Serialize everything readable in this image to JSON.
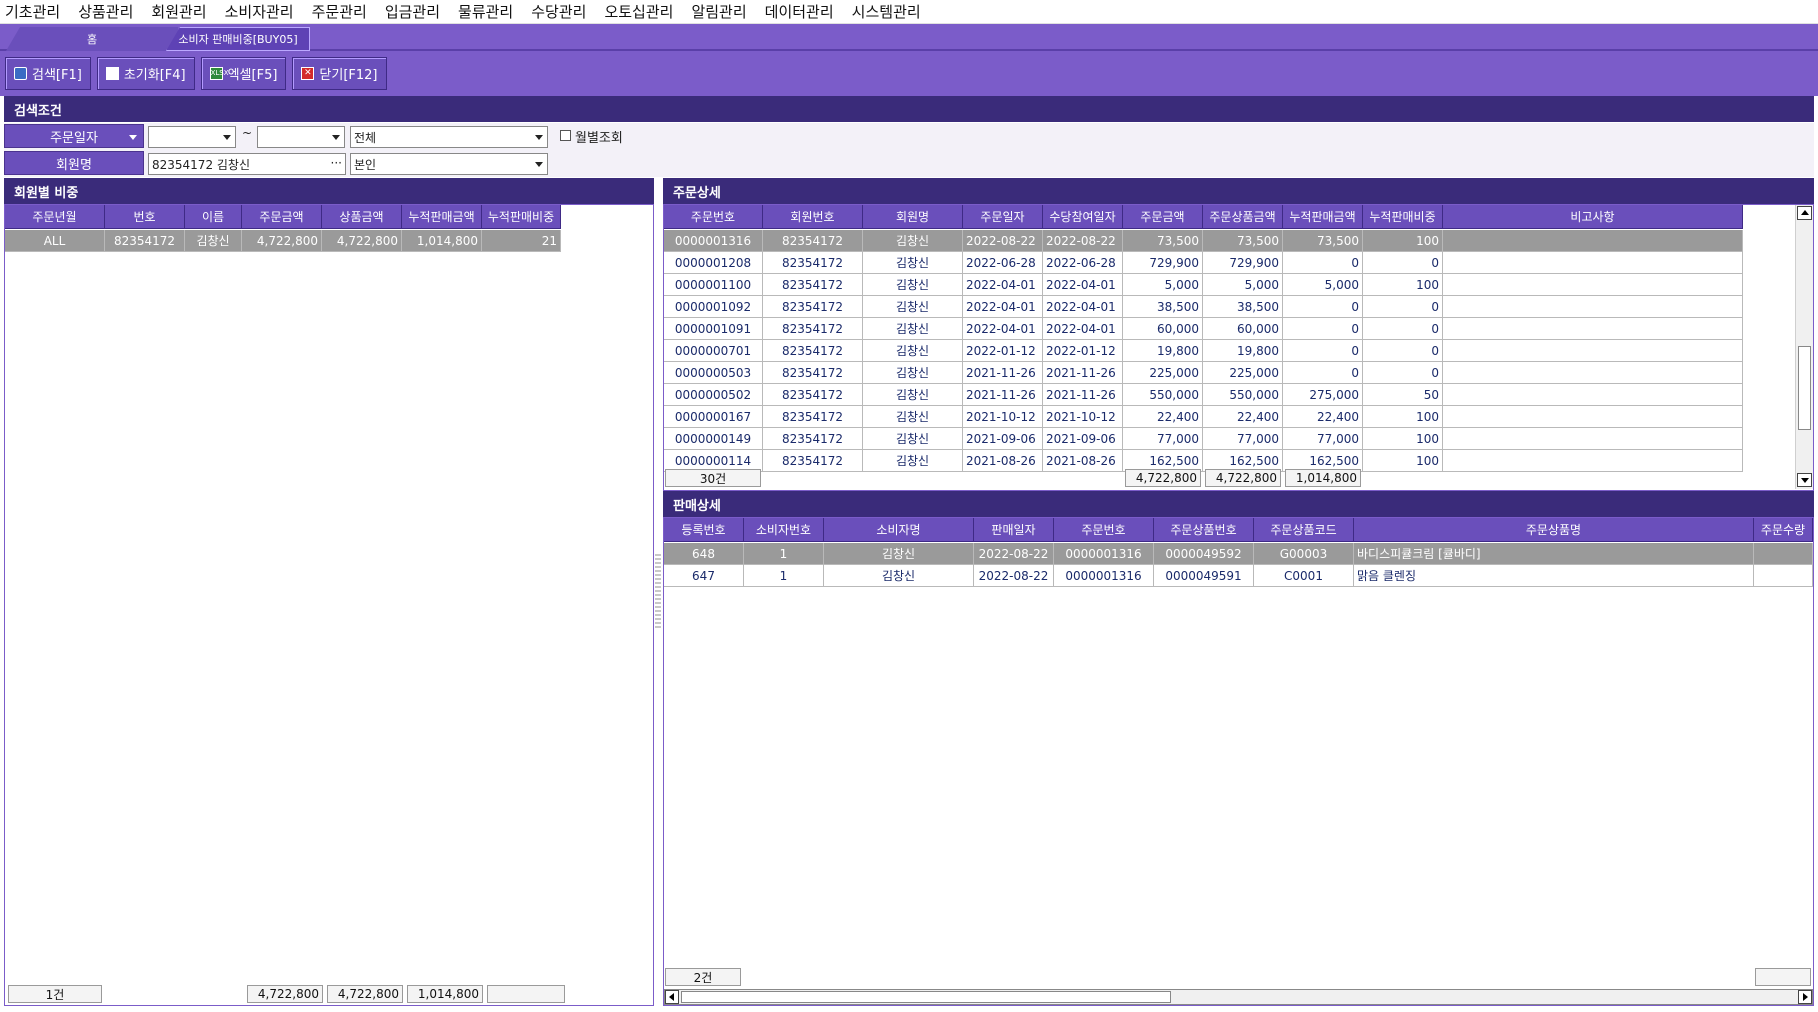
{
  "menu": [
    "기초관리",
    "상품관리",
    "회원관리",
    "소비자관리",
    "주문관리",
    "입금관리",
    "물류관리",
    "수당관리",
    "오토십관리",
    "알림관리",
    "데이터관리",
    "시스템관리"
  ],
  "tabs": {
    "home": "홈",
    "active": "소비자 판매비중[BUY05]"
  },
  "toolbar": {
    "search": "검색[F1]",
    "reset": "초기화[F4]",
    "excel": "엑셀[F5]",
    "close": "닫기[F12]",
    "excel_icon_text": "XLSX"
  },
  "search": {
    "title": "검색조건",
    "date_label": "주문일자",
    "date_from": "",
    "date_to": "",
    "tilde": "~",
    "scope": "전체",
    "monthly_label": "월별조회",
    "member_label": "회원명",
    "member_value": "82354172 김창신",
    "relation": "본인"
  },
  "left": {
    "title": "회원별 비중",
    "columns": [
      "주문년월",
      "번호",
      "이름",
      "주문금액",
      "상품금액",
      "누적판매금액",
      "누적판매비중"
    ],
    "rows": [
      [
        "ALL",
        "82354172",
        "김창신",
        "4,722,800",
        "4,722,800",
        "1,014,800",
        "21"
      ]
    ],
    "footer": {
      "count": "1건",
      "order_amt": "4,722,800",
      "product_amt": "4,722,800",
      "cum_amt": "1,014,800"
    }
  },
  "orders": {
    "title": "주문상세",
    "columns": [
      "주문번호",
      "회원번호",
      "회원명",
      "주문일자",
      "수당참여일자",
      "주문금액",
      "주문상품금액",
      "누적판매금액",
      "누적판매비중",
      "비고사항"
    ],
    "rows": [
      [
        "0000001316",
        "82354172",
        "김창신",
        "2022-08-22",
        "2022-08-22",
        "73,500",
        "73,500",
        "73,500",
        "100",
        ""
      ],
      [
        "0000001208",
        "82354172",
        "김창신",
        "2022-06-28",
        "2022-06-28",
        "729,900",
        "729,900",
        "0",
        "0",
        ""
      ],
      [
        "0000001100",
        "82354172",
        "김창신",
        "2022-04-01",
        "2022-04-01",
        "5,000",
        "5,000",
        "5,000",
        "100",
        ""
      ],
      [
        "0000001092",
        "82354172",
        "김창신",
        "2022-04-01",
        "2022-04-01",
        "38,500",
        "38,500",
        "0",
        "0",
        ""
      ],
      [
        "0000001091",
        "82354172",
        "김창신",
        "2022-04-01",
        "2022-04-01",
        "60,000",
        "60,000",
        "0",
        "0",
        ""
      ],
      [
        "0000000701",
        "82354172",
        "김창신",
        "2022-01-12",
        "2022-01-12",
        "19,800",
        "19,800",
        "0",
        "0",
        ""
      ],
      [
        "0000000503",
        "82354172",
        "김창신",
        "2021-11-26",
        "2021-11-26",
        "225,000",
        "225,000",
        "0",
        "0",
        ""
      ],
      [
        "0000000502",
        "82354172",
        "김창신",
        "2021-11-26",
        "2021-11-26",
        "550,000",
        "550,000",
        "275,000",
        "50",
        ""
      ],
      [
        "0000000167",
        "82354172",
        "김창신",
        "2021-10-12",
        "2021-10-12",
        "22,400",
        "22,400",
        "22,400",
        "100",
        ""
      ],
      [
        "0000000149",
        "82354172",
        "김창신",
        "2021-09-06",
        "2021-09-06",
        "77,000",
        "77,000",
        "77,000",
        "100",
        ""
      ],
      [
        "0000000114",
        "82354172",
        "김창신",
        "2021-08-26",
        "2021-08-26",
        "162,500",
        "162,500",
        "162,500",
        "100",
        ""
      ]
    ],
    "footer": {
      "count": "30건",
      "order_amt": "4,722,800",
      "product_amt": "4,722,800",
      "cum_amt": "1,014,800"
    }
  },
  "sales": {
    "title": "판매상세",
    "columns": [
      "등록번호",
      "소비자번호",
      "소비자명",
      "판매일자",
      "주문번호",
      "주문상품번호",
      "주문상품코드",
      "주문상품명",
      "주문수량"
    ],
    "rows": [
      [
        "648",
        "1",
        "김창신",
        "2022-08-22",
        "0000001316",
        "0000049592",
        "G00003",
        "바디스피큘크림 [큘바디]",
        ""
      ],
      [
        "647",
        "1",
        "김창신",
        "2022-08-22",
        "0000001316",
        "0000049591",
        "C0001",
        "맑음 클렌징",
        ""
      ]
    ],
    "footer": {
      "count": "2건"
    }
  },
  "colors": {
    "purple": "#7b5cc9",
    "dark": "#3a2b7a",
    "header": "#6a4fbb",
    "selected_row": "#9a9a9a"
  }
}
